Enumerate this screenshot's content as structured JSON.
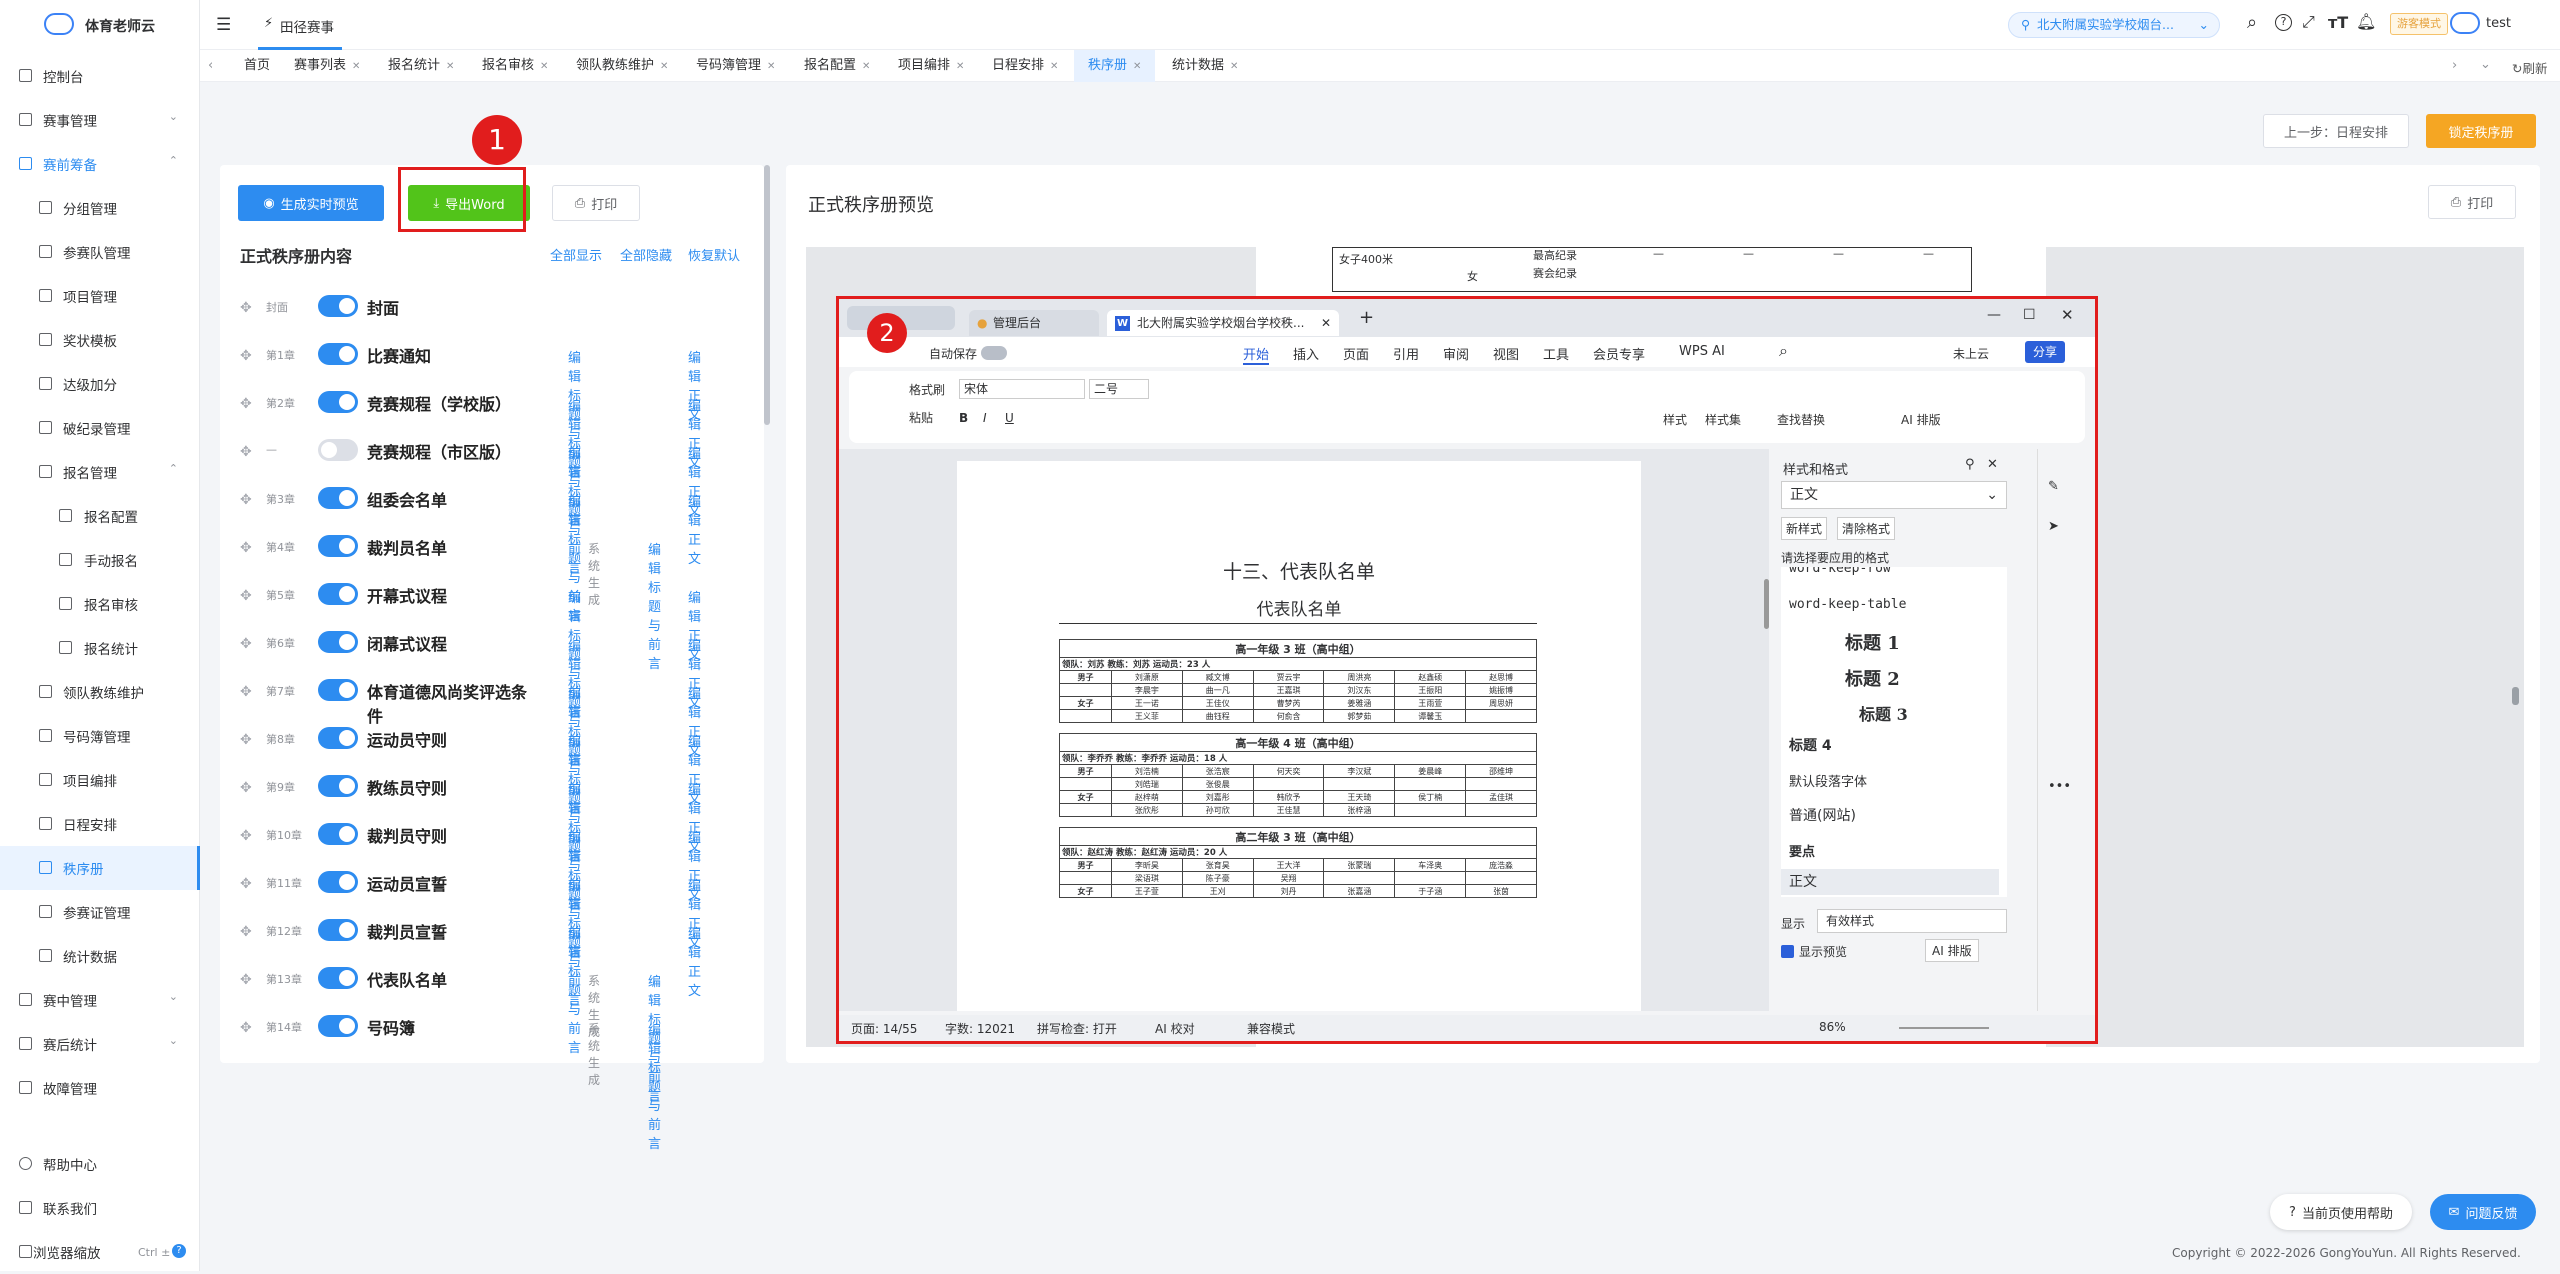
{
  "app": {
    "name": "体育老师云"
  },
  "sidebar": {
    "items": [
      {
        "label": "控制台"
      },
      {
        "label": "赛事管理"
      },
      {
        "label": "赛前筹备"
      },
      {
        "label": "分组管理"
      },
      {
        "label": "参赛队管理"
      },
      {
        "label": "项目管理"
      },
      {
        "label": "奖状模板"
      },
      {
        "label": "达级加分"
      },
      {
        "label": "破纪录管理"
      },
      {
        "label": "报名管理"
      },
      {
        "label": "报名配置"
      },
      {
        "label": "手动报名"
      },
      {
        "label": "报名审核"
      },
      {
        "label": "报名统计"
      },
      {
        "label": "领队教练维护"
      },
      {
        "label": "号码簿管理"
      },
      {
        "label": "项目编排"
      },
      {
        "label": "日程安排"
      },
      {
        "label": "秩序册"
      },
      {
        "label": "参赛证管理"
      },
      {
        "label": "统计数据"
      },
      {
        "label": "赛中管理"
      },
      {
        "label": "赛后统计"
      },
      {
        "label": "故障管理"
      }
    ],
    "bottom": [
      {
        "label": "帮助中心"
      },
      {
        "label": "联系我们"
      },
      {
        "label": "浏览器缩放",
        "shortcut": "Ctrl ±"
      }
    ]
  },
  "topbar": {
    "breadcrumb": "田径赛事",
    "school": "北大附属实验学校烟台...",
    "mode_badge": "游客模式",
    "user": "test"
  },
  "tags": [
    "首页",
    "赛事列表",
    "报名统计",
    "报名审核",
    "领队教练维护",
    "号码簿管理",
    "报名配置",
    "项目编排",
    "日程安排",
    "秩序册",
    "统计数据"
  ],
  "tags_refresh": "刷新",
  "actions": {
    "prev_step": "上一步：日程安排",
    "lock": "锁定秩序册"
  },
  "left_panel": {
    "btn_preview": "生成实时预览",
    "btn_export": "导出Word",
    "btn_print": "打印",
    "title": "正式秩序册内容",
    "show_all": "全部显示",
    "hide_all": "全部隐藏",
    "restore": "恢复默认",
    "edit_title": "编辑标题与前言",
    "edit_body": "编辑正文",
    "sys_gen": "系统生成",
    "chapters": [
      {
        "ch": "封面",
        "title": "封面",
        "on": true
      },
      {
        "ch": "第1章",
        "title": "比赛通知",
        "on": true
      },
      {
        "ch": "第2章",
        "title": "竞赛规程（学校版）",
        "on": true
      },
      {
        "ch": "—",
        "title": "竞赛规程（市区版）",
        "on": false
      },
      {
        "ch": "第3章",
        "title": "组委会名单",
        "on": true
      },
      {
        "ch": "第4章",
        "title": "裁判员名单",
        "on": true,
        "sys": true
      },
      {
        "ch": "第5章",
        "title": "开幕式议程",
        "on": true
      },
      {
        "ch": "第6章",
        "title": "闭幕式议程",
        "on": true
      },
      {
        "ch": "第7章",
        "title": "体育道德风尚奖评选条件",
        "on": true
      },
      {
        "ch": "第8章",
        "title": "运动员守则",
        "on": true
      },
      {
        "ch": "第9章",
        "title": "教练员守则",
        "on": true
      },
      {
        "ch": "第10章",
        "title": "裁判员守则",
        "on": true
      },
      {
        "ch": "第11章",
        "title": "运动员宣誓",
        "on": true
      },
      {
        "ch": "第12章",
        "title": "裁判员宣誓",
        "on": true
      },
      {
        "ch": "第13章",
        "title": "代表队名单",
        "on": true,
        "sys": true
      },
      {
        "ch": "第14章",
        "title": "号码簿",
        "on": true,
        "sys": true
      }
    ]
  },
  "annotations": {
    "one": "1",
    "two": "2"
  },
  "right_panel": {
    "title": "正式秩序册预览",
    "print": "打印"
  },
  "bg_doc": {
    "r1": "女子400米",
    "r2": "女",
    "c1": "最高纪录",
    "c2": "赛会纪录",
    "dash": "—"
  },
  "wps": {
    "tabs": [
      "管理后台",
      "北大附属实验学校烟台学校秩..."
    ],
    "menu": [
      "开始",
      "插入",
      "页面",
      "引用",
      "审阅",
      "视图",
      "工具",
      "会员专享",
      "WPS AI"
    ],
    "autosave": "自动保存",
    "cloud": "未上云",
    "share": "分享",
    "font": "宋体",
    "size": "二号",
    "ribbon": {
      "painter": "格式刷",
      "paste": "粘贴",
      "style": "样式",
      "styleset": "样式集",
      "find": "查找替换",
      "ai": "AI 排版"
    },
    "doc": {
      "h1": "十三、代表队名单",
      "h2": "代表队名单",
      "teams": [
        {
          "title": "高一年级 3 班（高中组）",
          "info": "领队：刘苏    教练：刘苏    运动员：23 人",
          "rows": [
            [
              "男子",
              "刘潇原",
              "臧文博",
              "贾云宇",
              "周洪亮",
              "赵鑫硕",
              "赵思博"
            ],
            [
              "",
              "李晨宇",
              "曲一凡",
              "王嘉琪",
              "刘汉东",
              "王振阳",
              "姚振博"
            ],
            [
              "女子",
              "王一诺",
              "王佳仪",
              "曹梦芮",
              "姜雅涵",
              "王雨萱",
              "周思妍"
            ],
            [
              "",
              "王义菲",
              "曲钰程",
              "何俞含",
              "郭梦茹",
              "谭馨玉",
              ""
            ]
          ]
        },
        {
          "title": "高一年级 4 班（高中组）",
          "info": "领队：李乔乔    教练：李乔乔    运动员：18 人",
          "rows": [
            [
              "男子",
              "刘浩楠",
              "张浩宸",
              "何天奕",
              "李汉斌",
              "姜晨峰",
              "邵维坤"
            ],
            [
              "",
              "刘皓瑞",
              "张俊晨",
              "",
              "",
              "",
              ""
            ],
            [
              "女子",
              "赵梓萌",
              "刘嘉彤",
              "韩欣予",
              "王天琦",
              "侯丁楠",
              "孟佳琪"
            ],
            [
              "",
              "张欣彤",
              "孙可欣",
              "王佳慧",
              "张梓涵",
              "",
              ""
            ]
          ]
        },
        {
          "title": "高二年级 3 班（高中组）",
          "info": "领队：赵红涛    教练：赵红涛    运动员：20 人",
          "rows": [
            [
              "男子",
              "李昕昊",
              "张育昊",
              "王大洋",
              "张蒙瑞",
              "车泽奥",
              "庞浩淼"
            ],
            [
              "",
              "梁语琪",
              "陈子豪",
              "吴翔",
              "",
              "",
              ""
            ],
            [
              "女子",
              "王子萱",
              "王刈",
              "刘丹",
              "张嘉涵",
              "于子涵",
              "张茵"
            ]
          ]
        }
      ]
    },
    "styles_pane": {
      "title": "样式和格式",
      "current": "正文",
      "new": "新样式",
      "clear": "清除格式",
      "apply": "请选择要应用的格式",
      "list": [
        "word-keep-row",
        "word-keep-table",
        "标题 1",
        "标题 2",
        "标题 3",
        "标题 4",
        "默认段落字体",
        "普通(网站)",
        "要点",
        "正文"
      ],
      "show": "显示",
      "show_val": "有效样式",
      "preview": "显示预览",
      "ai": "AI 排版"
    },
    "status": {
      "page": "页面: 14/55",
      "words": "字数: 12021",
      "spell": "拼写检查: 打开",
      "aicheck": "AI 校对",
      "compat": "兼容模式",
      "zoom": "86%"
    }
  },
  "footer": {
    "help": "当前页使用帮助",
    "feedback": "问题反馈",
    "copyright": "Copyright © 2022-2026 GongYouYun. All Rights Reserved."
  }
}
